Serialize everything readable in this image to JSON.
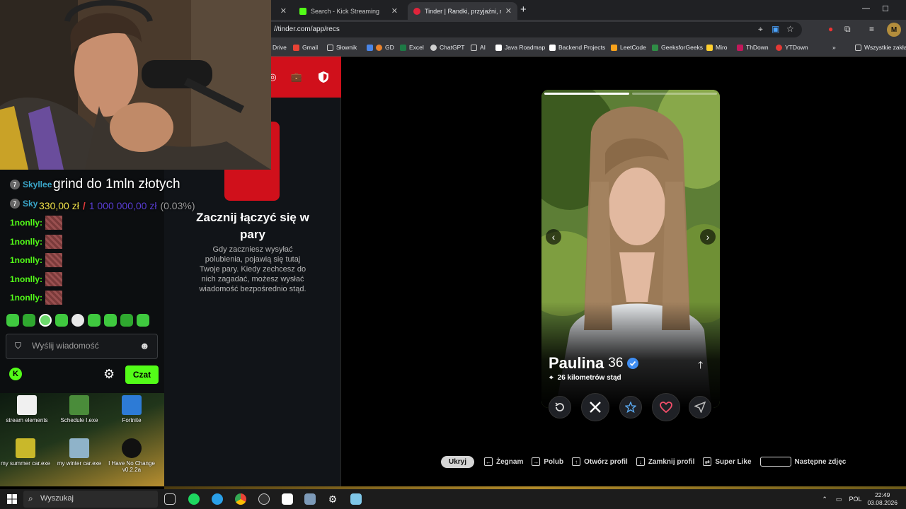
{
  "browser": {
    "tabs": [
      {
        "label": "",
        "active": false
      },
      {
        "label": "Search - Kick Streaming",
        "active": false,
        "favicon_color": "#53fc18"
      },
      {
        "label": "Tinder | Randki, przyjaźni, nowe",
        "active": true,
        "favicon_color": "#e0243b"
      }
    ],
    "new_tab_label": "+",
    "url": "//tinder.com/app/recs",
    "profile_initial": "M",
    "bookmarks": [
      {
        "label": "Drive",
        "color": ""
      },
      {
        "label": "Gmail",
        "color": "#ea4335"
      },
      {
        "label": "Słownik",
        "color": ""
      },
      {
        "label": "GD",
        "color": "#e8812c"
      },
      {
        "label": "Excel",
        "color": "#1d7a45"
      },
      {
        "label": "ChatGPT",
        "color": "#cfcfcf"
      },
      {
        "label": "AI",
        "color": ""
      },
      {
        "label": "Java Roadmap",
        "color": "#000000"
      },
      {
        "label": "Backend Projects",
        "color": "#000000"
      },
      {
        "label": "LeetCode",
        "color": "#f8a21b"
      },
      {
        "label": "GeeksforGeeks",
        "color": "#2f8d46"
      },
      {
        "label": "Miro",
        "color": "#ffd02f"
      },
      {
        "label": "ThDown",
        "color": "#c2185b"
      },
      {
        "label": "YTDown",
        "color": "#e53935"
      },
      {
        "label": "Wszystkie zakła",
        "color": ""
      }
    ]
  },
  "tinder": {
    "empty_title": "Zacznij łączyć się w pary",
    "empty_text": "Gdy zaczniesz wysyłać polubienia, pojawią się tutaj Twoje pary. Kiedy zechcesz do nich zagadać, możesz wysłać wiadomość bezpośrednio stąd.",
    "profile": {
      "name": "Paulina",
      "age": "36",
      "distance": "26 kilometrów stąd",
      "photo_count": 2,
      "current_photo": 1
    },
    "hotkeys": {
      "hide": "Ukryj",
      "items": [
        {
          "key": "←",
          "label": "Żegnam"
        },
        {
          "key": "→",
          "label": "Polub"
        },
        {
          "key": "↑",
          "label": "Otwórz profil"
        },
        {
          "key": "↓",
          "label": "Zamknij profil"
        },
        {
          "key": "⇄",
          "label": "Super Like"
        },
        {
          "key": "",
          "label": "Następne zdjęc"
        }
      ]
    },
    "brand_color": "#d0101b"
  },
  "stream": {
    "goal_title": "grind do 1mln złotych",
    "goal_current": "330,00 zł",
    "goal_separator": "/",
    "goal_target": "1 000 000,00 zł",
    "goal_percent": "(0.03%)",
    "chat": {
      "messages": [
        {
          "badge": "7",
          "user": "Skyllee",
          "color": "#3aa6c9"
        },
        {
          "badge": "7",
          "user": "Sky",
          "color": "#3aa6c9"
        },
        {
          "badge": "",
          "user": "1nonlly:",
          "color": "#53fc18"
        },
        {
          "badge": "",
          "user": "1nonlly:",
          "color": "#53fc18"
        },
        {
          "badge": "",
          "user": "1nonlly:",
          "color": "#53fc18"
        },
        {
          "badge": "",
          "user": "1nonlly:",
          "color": "#53fc18"
        },
        {
          "badge": "",
          "user": "1nonlly:",
          "color": "#53fc18"
        }
      ],
      "input_placeholder": "Wyślij wiadomość",
      "send_label": "Czat",
      "kick_logo": "K"
    }
  },
  "desktop": {
    "icons": [
      {
        "label": "stream elements"
      },
      {
        "label": "Schedule I.exe"
      },
      {
        "label": "Fortnite"
      },
      {
        "label": "my summer car.exe"
      },
      {
        "label": "my winter car.exe"
      },
      {
        "label": "I Have No Change v0.2.2a"
      }
    ]
  },
  "taskbar": {
    "search_placeholder": "Wyszukaj",
    "language": "POL",
    "time": "22:49",
    "date": "03.08.2026"
  }
}
